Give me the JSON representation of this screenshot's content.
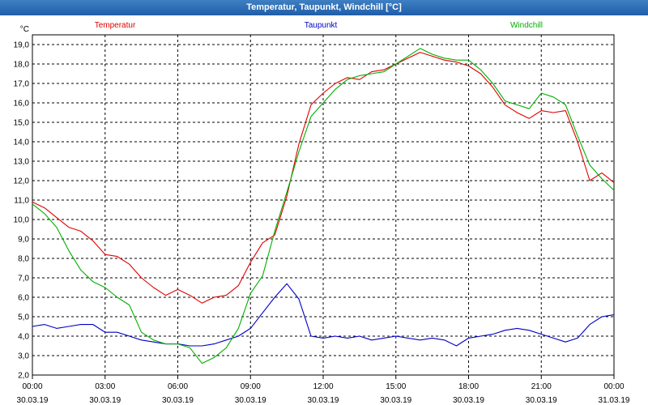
{
  "window": {
    "title": "Temperatur, Taupunkt, Windchill [°C]"
  },
  "chart_data": {
    "type": "line",
    "title": "Temperatur, Taupunkt, Windchill [°C]",
    "ylabel": "°C",
    "ylim": [
      2.0,
      19.5
    ],
    "xlim": [
      0,
      24
    ],
    "grid": true,
    "legend_position": "top",
    "y_ticks": [
      "2,0",
      "3,0",
      "4,0",
      "5,0",
      "6,0",
      "7,0",
      "8,0",
      "9,0",
      "10,0",
      "11,0",
      "12,0",
      "13,0",
      "14,0",
      "15,0",
      "16,0",
      "17,0",
      "18,0",
      "19,0"
    ],
    "x_ticks": [
      {
        "time": "00:00",
        "date": "30.03.19"
      },
      {
        "time": "03:00",
        "date": "30.03.19"
      },
      {
        "time": "06:00",
        "date": "30.03.19"
      },
      {
        "time": "09:00",
        "date": "30.03.19"
      },
      {
        "time": "12:00",
        "date": "30.03.19"
      },
      {
        "time": "15:00",
        "date": "30.03.19"
      },
      {
        "time": "18:00",
        "date": "30.03.19"
      },
      {
        "time": "21:00",
        "date": "30.03.19"
      },
      {
        "time": "00:00",
        "date": "31.03.19"
      }
    ],
    "series": [
      {
        "name": "Temperatur",
        "color": "#e00000",
        "x": [
          0,
          0.5,
          1,
          1.5,
          2,
          2.5,
          3,
          3.5,
          4,
          4.5,
          5,
          5.5,
          6,
          6.5,
          7,
          7.5,
          8,
          8.5,
          9,
          9.5,
          10,
          10.5,
          11,
          11.5,
          12,
          12.5,
          13,
          13.5,
          14,
          14.5,
          15,
          15.5,
          16,
          16.5,
          17,
          17.5,
          18,
          18.5,
          19,
          19.5,
          20,
          20.5,
          21,
          21.5,
          22,
          22.5,
          23,
          23.5,
          24
        ],
        "values": [
          10.9,
          10.6,
          10.1,
          9.6,
          9.4,
          8.9,
          8.2,
          8.1,
          7.7,
          7.0,
          6.5,
          6.1,
          6.4,
          6.1,
          5.7,
          6.0,
          6.1,
          6.6,
          7.8,
          8.8,
          9.2,
          11.2,
          13.9,
          15.9,
          16.5,
          17.0,
          17.3,
          17.2,
          17.6,
          17.7,
          18.0,
          18.3,
          18.6,
          18.4,
          18.2,
          18.1,
          17.9,
          17.5,
          16.8,
          15.9,
          15.5,
          15.2,
          15.6,
          15.5,
          15.6,
          14.0,
          12.0,
          12.4,
          11.9
        ]
      },
      {
        "name": "Taupunkt",
        "color": "#0000c8",
        "x": [
          0,
          0.5,
          1,
          1.5,
          2,
          2.5,
          3,
          3.5,
          4,
          4.5,
          5,
          5.5,
          6,
          6.5,
          7,
          7.5,
          8,
          8.5,
          9,
          9.5,
          10,
          10.5,
          11,
          11.5,
          12,
          12.5,
          13,
          13.5,
          14,
          14.5,
          15,
          15.5,
          16,
          16.5,
          17,
          17.5,
          18,
          18.5,
          19,
          19.5,
          20,
          20.5,
          21,
          21.5,
          22,
          22.5,
          23,
          23.5,
          24
        ],
        "values": [
          4.5,
          4.6,
          4.4,
          4.5,
          4.6,
          4.6,
          4.2,
          4.2,
          4.0,
          3.8,
          3.7,
          3.6,
          3.6,
          3.5,
          3.5,
          3.6,
          3.8,
          4.0,
          4.4,
          5.2,
          6.0,
          6.7,
          5.9,
          4.0,
          3.9,
          4.0,
          3.9,
          4.0,
          3.8,
          3.9,
          4.0,
          3.9,
          3.8,
          3.9,
          3.8,
          3.5,
          3.9,
          4.0,
          4.1,
          4.3,
          4.4,
          4.3,
          4.1,
          3.9,
          3.7,
          3.9,
          4.6,
          5.0,
          5.1
        ]
      },
      {
        "name": "Windchill",
        "color": "#00b000",
        "x": [
          0,
          0.5,
          1,
          1.5,
          2,
          2.5,
          3,
          3.5,
          4,
          4.5,
          5,
          5.5,
          6,
          6.5,
          7,
          7.5,
          8,
          8.5,
          9,
          9.5,
          10,
          10.5,
          11,
          11.5,
          12,
          12.5,
          13,
          13.5,
          14,
          14.5,
          15,
          15.5,
          16,
          16.5,
          17,
          17.5,
          18,
          18.5,
          19,
          19.5,
          20,
          20.5,
          21,
          21.5,
          22,
          22.5,
          23,
          23.5,
          24
        ],
        "values": [
          10.8,
          10.3,
          9.6,
          8.4,
          7.4,
          6.8,
          6.5,
          6.0,
          5.6,
          4.2,
          3.8,
          3.6,
          3.6,
          3.4,
          2.6,
          2.9,
          3.4,
          4.4,
          6.2,
          7.1,
          9.4,
          11.4,
          13.5,
          15.3,
          16.0,
          16.7,
          17.2,
          17.4,
          17.5,
          17.6,
          18.0,
          18.4,
          18.8,
          18.5,
          18.3,
          18.2,
          18.2,
          17.7,
          17.0,
          16.1,
          15.9,
          15.7,
          16.5,
          16.3,
          15.9,
          14.3,
          12.8,
          12.1,
          11.5
        ]
      }
    ]
  }
}
